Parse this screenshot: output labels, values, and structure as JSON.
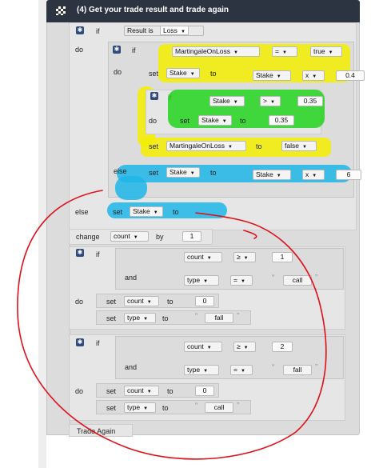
{
  "header": {
    "title": "(4) Get your trade result and trade again"
  },
  "kw": {
    "if": "if",
    "do": "do",
    "else": "else",
    "set": "set",
    "to": "to",
    "and": "and",
    "change": "change",
    "by": "by"
  },
  "blocks": {
    "outer_if": {
      "var": "Result is",
      "value": "Loss"
    },
    "inner_if": {
      "var": "MartingaleOnLoss",
      "op": "=",
      "value": "true"
    },
    "set_stake_mult": {
      "var": "Stake",
      "src": "Stake",
      "op": "x",
      "num": "0.4"
    },
    "cap_if": {
      "var": "Stake",
      "op": ">",
      "num": "0.35"
    },
    "cap_set": {
      "var": "Stake",
      "num": "0.35"
    },
    "set_martingale": {
      "var": "MartingaleOnLoss",
      "value": "false"
    },
    "else_set": {
      "var": "Stake",
      "src": "Stake",
      "op": "x",
      "num": "6"
    },
    "win_set": {
      "var": "Stake"
    },
    "change_count": {
      "var": "count",
      "num": "1"
    },
    "fall_if": {
      "count_var": "count",
      "op1": "≥",
      "num": "1",
      "type_var": "type",
      "op2": "=",
      "str": "call"
    },
    "fall_do": {
      "count_var": "count",
      "count_num": "0",
      "type_var": "type",
      "str": "fall"
    },
    "call_if": {
      "count_var": "count",
      "op1": "≥",
      "num": "2",
      "type_var": "type",
      "op2": "=",
      "str": "fall"
    },
    "call_do": {
      "count_var": "count",
      "count_num": "0",
      "type_var": "type",
      "str": "call"
    },
    "trade_again": "Trade Again"
  },
  "colors": {
    "header_bg": "#2b3440",
    "highlight_yellow": "#f5ee00",
    "highlight_green": "#22d41e",
    "highlight_cyan": "#1fb6e8",
    "annotation_red": "#e0101a"
  },
  "icons": {
    "header": "checkered-flag-icon",
    "mutator": "gear-icon",
    "dropdown": "triangle-down-icon",
    "quote": "quote-icon"
  }
}
